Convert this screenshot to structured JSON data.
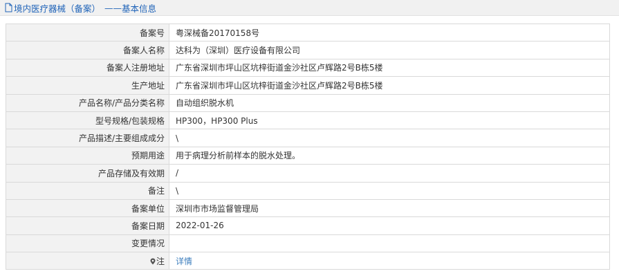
{
  "header": {
    "title": "境内医疗器械（备案）",
    "separator": "——",
    "subtitle": "基本信息"
  },
  "rows": [
    {
      "label": "备案号",
      "value": "粤深械备20170158号"
    },
    {
      "label": "备案人名称",
      "value": "达科为（深圳）医疗设备有限公司"
    },
    {
      "label": "备案人注册地址",
      "value": "广东省深圳市坪山区坑梓街道金沙社区卢辉路2号B栋5楼"
    },
    {
      "label": "生产地址",
      "value": "广东省深圳市坪山区坑梓街道金沙社区卢辉路2号B栋5楼"
    },
    {
      "label": "产品名称/产品分类名称",
      "value": "自动组织脱水机"
    },
    {
      "label": "型号规格/包装规格",
      "value": "HP300，HP300 Plus"
    },
    {
      "label": "产品描述/主要组成成分",
      "value": "\\"
    },
    {
      "label": "预期用途",
      "value": "用于病理分析前样本的脱水处理。"
    },
    {
      "label": "产品存储及有效期",
      "value": "/"
    },
    {
      "label": "备注",
      "value": "\\"
    },
    {
      "label": "备案单位",
      "value": "深圳市市场监督管理局"
    },
    {
      "label": "备案日期",
      "value": "2022-01-26"
    },
    {
      "label": "变更情况",
      "value": ""
    },
    {
      "label": "注",
      "value": "详情",
      "is_link": true,
      "label_icon": "pin-icon"
    }
  ],
  "colors": {
    "accent": "#1f63b8",
    "link": "#3c7ebd",
    "label_bg": "#f2f2f2",
    "border": "#d9d9d9"
  }
}
